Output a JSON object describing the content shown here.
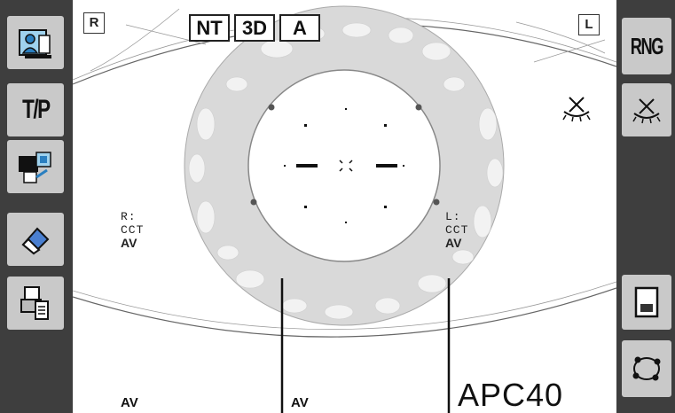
{
  "header": {
    "right_eye_label": "R",
    "left_eye_label": "L",
    "modes": [
      "NT",
      "3D",
      "A"
    ]
  },
  "left_sidebar": {
    "buttons": [
      {
        "name": "patient-data",
        "icon": "patient-id-icon"
      },
      {
        "name": "tp",
        "label": "T/P"
      },
      {
        "name": "camera-print",
        "icon": "camera-print-icon"
      },
      {
        "name": "erase",
        "icon": "eraser-icon"
      },
      {
        "name": "print",
        "icon": "print-icon"
      }
    ]
  },
  "right_sidebar": {
    "rng_label": "RNG",
    "buttons": [
      {
        "name": "rng",
        "label": "RNG"
      },
      {
        "name": "blink",
        "icon": "closed-eye-icon"
      },
      {
        "name": "report",
        "icon": "report-icon"
      },
      {
        "name": "ring",
        "icon": "ring-points-icon"
      }
    ]
  },
  "measurements": {
    "right": {
      "side": "R:",
      "cct": "CCT",
      "av": "AV"
    },
    "left": {
      "side": "L:",
      "cct": "CCT",
      "av": "AV"
    },
    "bottom_av_1": "AV",
    "bottom_av_2": "AV"
  },
  "model_name": "APC40",
  "colors": {
    "sidebar": "#3e3e3e",
    "button": "#c9c9c9",
    "accent_blue": "#2a7fc0"
  }
}
